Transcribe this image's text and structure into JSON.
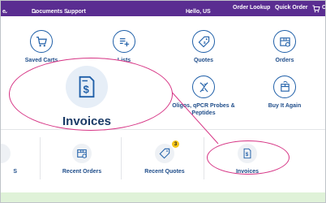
{
  "topbar": {
    "items": [
      "e",
      "Documents",
      "Support",
      "Hello, US",
      "Order Lookup",
      "Quick Order",
      "C"
    ],
    "bg_color": "#5a2d91"
  },
  "grid": {
    "row1": [
      "Saved Carts",
      "Lists",
      "Quotes",
      "Orders"
    ],
    "row2": [
      "Oligos, qPCR Probes & Peptides",
      "Buy It Again"
    ]
  },
  "bottom": {
    "items": [
      "S",
      "Recent Orders",
      "Recent Quotes",
      "Invoices"
    ],
    "quotes_badge": "3"
  },
  "callout": {
    "label": "Invoices",
    "accent": "#d63384"
  },
  "colors": {
    "icon_blue": "#1f5fa8",
    "label_blue": "#1f4d8a"
  }
}
